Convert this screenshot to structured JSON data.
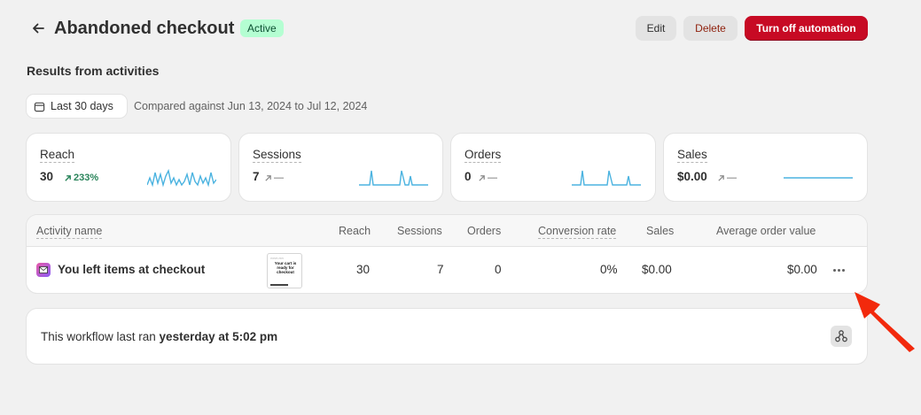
{
  "header": {
    "title": "Abandoned checkout",
    "status_badge": "Active",
    "edit_label": "Edit",
    "delete_label": "Delete",
    "turn_off_label": "Turn off automation"
  },
  "results": {
    "section_title": "Results from activities",
    "date_range_label": "Last 30 days",
    "compared_text": "Compared against Jun 13, 2024 to Jul 12, 2024"
  },
  "metrics": [
    {
      "label": "Reach",
      "value": "30",
      "delta": "233%",
      "trend": "up"
    },
    {
      "label": "Sessions",
      "value": "7",
      "delta": "—",
      "trend": "flat"
    },
    {
      "label": "Orders",
      "value": "0",
      "delta": "—",
      "trend": "flat"
    },
    {
      "label": "Sales",
      "value": "$0.00",
      "delta": "—",
      "trend": "flat"
    }
  ],
  "table": {
    "columns": [
      "Activity name",
      "Reach",
      "Sessions",
      "Orders",
      "Conversion rate",
      "Sales",
      "Average order value"
    ],
    "rows": [
      {
        "name": "You left items at checkout",
        "thumbnail_heading": "Your cart is ready for checkout",
        "reach": "30",
        "sessions": "7",
        "orders": "0",
        "conversion_rate": "0%",
        "sales": "$0.00",
        "average_order_value": "$0.00"
      }
    ]
  },
  "footer": {
    "prefix": "This workflow last ran ",
    "last_ran": "yesterday at 5:02 pm"
  },
  "colors": {
    "accent_red": "#c70a24",
    "sparkline": "#4bb3e0",
    "badge_bg": "#b4fed2",
    "annotation_arrow": "#f2290c"
  },
  "icons": {
    "back": "arrow-left-icon",
    "calendar": "calendar-icon",
    "trend_up": "arrow-up-right-icon",
    "mail": "mail-icon",
    "more": "ellipsis-icon",
    "workflow": "workflow-icon"
  }
}
